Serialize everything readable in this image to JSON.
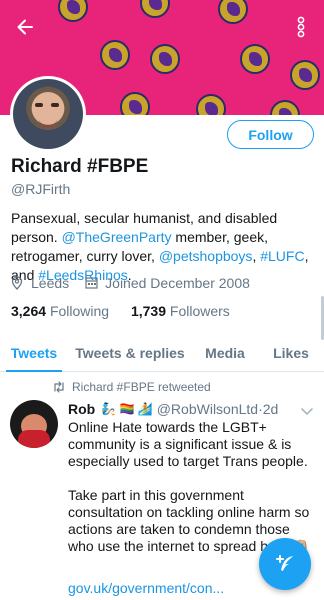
{
  "header": {
    "back_icon": "arrow-left-icon",
    "more_icon": "vertical-dots-icon",
    "banner_color": "#e8237a"
  },
  "profile": {
    "name": "Richard #FBPE",
    "handle": "@RJFirth",
    "follow_label": "Follow",
    "bio": {
      "line1": "Pansexual, secular humanist, and disabled person.",
      "party": "@TheGreenParty",
      "mid1": " member, geek, retrogamer, curry lover, ",
      "pet": "@petshopboys",
      "comma": ", ",
      "lufc": "#LUFC",
      "and": ", and ",
      "rhinos": "#LeedsRhinos",
      "end": "."
    },
    "location": "Leeds",
    "joined": "Joined December 2008",
    "following_count": "3,264",
    "following_label": "Following",
    "followers_count": "1,739",
    "followers_label": "Followers"
  },
  "tabs": [
    {
      "label": "Tweets",
      "active": true
    },
    {
      "label": "Tweets & replies",
      "active": false
    },
    {
      "label": "Media",
      "active": false
    },
    {
      "label": "Likes",
      "active": false
    }
  ],
  "timeline": {
    "retweet_text": "Richard #FBPE retweeted",
    "tweet": {
      "author": "Rob",
      "emoji": "🧞 🏳️‍🌈 🏄",
      "handle": "@RobWilsonLtd",
      "dot": " · ",
      "time": "2d",
      "para1": "Online Hate towards the LGBT+ community is a significant issue & is especially used to target Trans people.",
      "para2": "Take part in this government consultation on tackling online harm so actions are taken to condemn those who use the internet to spread hate 👊🏼",
      "link": "gov.uk/government/con..."
    }
  },
  "colors": {
    "accent": "#1da1f2",
    "link": "#1b95e0",
    "muted": "#657786"
  }
}
